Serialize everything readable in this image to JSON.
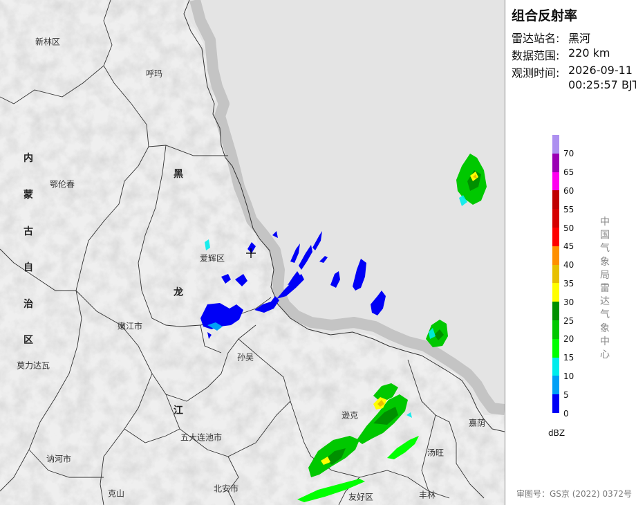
{
  "panel": {
    "title": "组合反射率",
    "station": {
      "label": "雷达站名:",
      "value": "黑河"
    },
    "range": {
      "label": "数据范围:",
      "value": "220 km"
    },
    "time": {
      "label": "观测时间:",
      "value_date": "2026-09-11",
      "value_time": "00:25:57 BJT"
    },
    "legend": {
      "unit": "dBZ",
      "ticks": [
        "70",
        "65",
        "60",
        "55",
        "50",
        "45",
        "40",
        "35",
        "30",
        "25",
        "20",
        "15",
        "10",
        "5",
        "0"
      ],
      "colors": [
        "#ad90f0",
        "#9b00b4",
        "#ff00f0",
        "#c00000",
        "#d60000",
        "#ff0000",
        "#ff9000",
        "#e7c000",
        "#ffff00",
        "#009000",
        "#00c800",
        "#00ff00",
        "#00ecec",
        "#01a0f6",
        "#0000f6"
      ]
    },
    "agency": "中国气象局雷达气象中心",
    "approval": "审图号：GS京 (2022) 0372号"
  },
  "map": {
    "places": [
      {
        "name": "新林区"
      },
      {
        "name": "呼玛"
      },
      {
        "name": "鄂伦春"
      },
      {
        "name": "爱辉区"
      },
      {
        "name": "嫩江市"
      },
      {
        "name": "孙吴"
      },
      {
        "name": "莫力达瓦"
      },
      {
        "name": "逊克"
      },
      {
        "name": "嘉荫"
      },
      {
        "name": "五大连池市"
      },
      {
        "name": "汤旺"
      },
      {
        "name": "讷河市"
      },
      {
        "name": "克山"
      },
      {
        "name": "北安市"
      },
      {
        "name": "友好区"
      },
      {
        "name": "丰林"
      }
    ],
    "region_labels": [
      {
        "text": "内蒙古自治区",
        "chars": [
          "内",
          "蒙",
          "古",
          "自",
          "治",
          "区"
        ]
      },
      {
        "text": "黑龙江",
        "chars": [
          "黑",
          "龙",
          "江"
        ]
      }
    ],
    "colors": {
      "land": "#efefef",
      "foreign": "#e4e4e4",
      "border": "#c4c4c4",
      "lines": "#333333"
    }
  }
}
